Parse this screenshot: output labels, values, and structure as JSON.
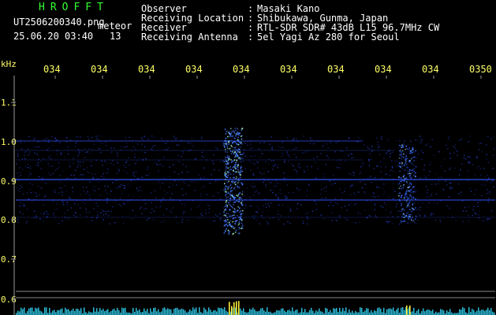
{
  "header": {
    "brand": "HROFFT",
    "filename": "UT2506200340.png",
    "datetime": "25.06.20 03:40",
    "tag": "meteor",
    "count": "13"
  },
  "info": {
    "observer_label": "Observer",
    "observer_value": "Masaki Kano",
    "location_label": "Receiving Location",
    "location_value": "Shibukawa, Gunma, Japan",
    "receiver_label": "Receiver",
    "receiver_value": "RTL-SDR SDR# 43dB L15 96.7MHz CW",
    "antenna_label": "Receiving Antenna",
    "antenna_value": "5el Yagi Az 280 for Seoul"
  },
  "axis": {
    "y_unit": "kHz",
    "y_ticks": [
      "1.1",
      "1.0",
      "0.9",
      "0.8",
      "0.7",
      "0.6"
    ],
    "x_ticks": [
      "034",
      "034",
      "034",
      "034",
      "034",
      "034",
      "034",
      "034",
      "034",
      "0350"
    ]
  },
  "colors": {
    "background": "#000000",
    "title_green": "#33ff33",
    "tick_yellow": "#ffff66",
    "signal_blue": "#3355ff",
    "signal_bright": "#88ccff",
    "bottom_cyan": "#33ddff"
  }
}
